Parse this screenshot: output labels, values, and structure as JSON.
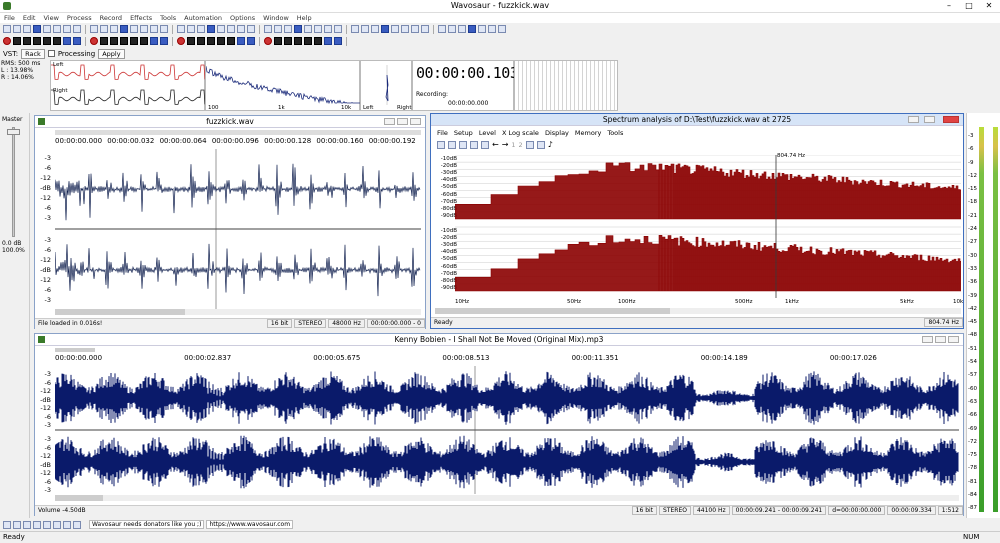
{
  "app": {
    "title": "Wavosaur - fuzzkick.wav"
  },
  "menu": [
    "File",
    "Edit",
    "View",
    "Process",
    "Record",
    "Effects",
    "Tools",
    "Automation",
    "Options",
    "Window",
    "Help"
  ],
  "vst": {
    "label": "VST:",
    "rack": "Rack",
    "processing": "Processing",
    "apply": "Apply"
  },
  "meters_top": {
    "rms": "RMS: 500 ms",
    "l": "L : 13.98%",
    "r": "R : 14.06%",
    "left": "Left",
    "right": "Right",
    "freq": [
      "100",
      "1k",
      "10k"
    ],
    "lr_left": "Left",
    "lr_right": "Right"
  },
  "clock": {
    "time": "00:00:00.103",
    "recording": "Recording:",
    "rec_time": "00:00:00.000"
  },
  "master": {
    "label": "Master",
    "db": "0.0 dB",
    "pct": "100.0%"
  },
  "wave1": {
    "title": "fuzzkick.wav",
    "ruler": [
      "00:00:00.000",
      "00:00:00.032",
      "00:00:00.064",
      "00:00:00.096",
      "00:00:00.128",
      "00:00:00.160",
      "00:00:00.192"
    ],
    "scale": [
      "-3",
      "-6",
      "-12",
      "-dB",
      "-12",
      "-6",
      "-3"
    ],
    "status": "File loaded in 0.016s!",
    "bits": "16 bit",
    "mode": "STEREO",
    "rate": "48000 Hz",
    "pos": "00:00:00.000 - 0"
  },
  "spectrum": {
    "title": "Spectrum analysis of D:\\Test\\fuzzkick.wav at 2725",
    "menu": [
      "File",
      "Setup",
      "Level",
      "X Log scale",
      "Display",
      "Memory",
      "Tools"
    ],
    "db": [
      "-10dB",
      "-20dB",
      "-30dB",
      "-40dB",
      "-50dB",
      "-60dB",
      "-70dB",
      "-80dB",
      "-90dB"
    ],
    "freq": [
      "10Hz",
      "50Hz",
      "100Hz",
      "500Hz",
      "1kHz",
      "5kHz",
      "10k"
    ],
    "marker": "804.74 Hz",
    "status_left": "Ready",
    "status_right": "804.74 Hz",
    "toolbar_nums": [
      "1",
      "2"
    ],
    "colors": {
      "fill": "#8b0000"
    }
  },
  "wave2": {
    "title": "Kenny Bobien - I Shall Not Be Moved (Original Mix).mp3",
    "ruler": [
      "00:00:00.000",
      "00:00:02.837",
      "00:00:05.675",
      "00:00:08.513",
      "00:00:11.351",
      "00:00:14.189",
      "00:00:17.026"
    ],
    "scale": [
      "-3",
      "-6",
      "-12",
      "-dB",
      "-12",
      "-6",
      "-3"
    ],
    "volume": "Volume -4.50dB",
    "bits": "16 bit",
    "mode": "STEREO",
    "rate": "44100 Hz",
    "sel": "00:00:09.241 - 00:00:09.241",
    "dur": "d=00:00:00.000",
    "pos": "00:00:09.334",
    "zoom": "1:512"
  },
  "vu": [
    "-3",
    "-6",
    "-9",
    "-12",
    "-15",
    "-18",
    "-21",
    "-24",
    "-27",
    "-30",
    "-33",
    "-36",
    "-39",
    "-42",
    "-45",
    "-48",
    "-51",
    "-54",
    "-57",
    "-60",
    "-63",
    "-66",
    "-69",
    "-72",
    "-75",
    "-78",
    "-81",
    "-84",
    "-87"
  ],
  "bottom": {
    "donate": "Wavosaur needs donators like you ;)",
    "url": "https://www.wavosaur.com"
  },
  "statusbar": {
    "left": "Ready",
    "num": "NUM"
  }
}
